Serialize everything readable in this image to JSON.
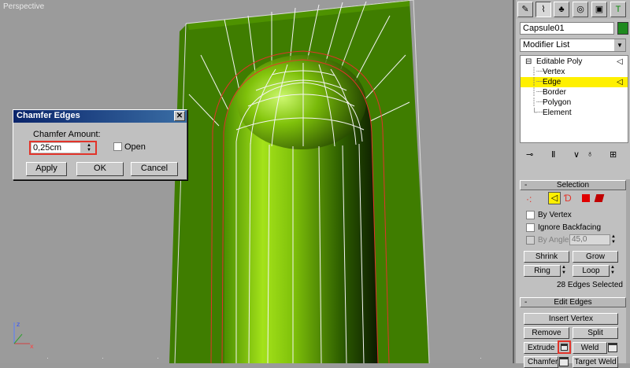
{
  "viewport": {
    "label": "Perspective"
  },
  "dialog": {
    "title": "Chamfer Edges",
    "close_glyph": "✕",
    "amount_label": "Chamfer Amount:",
    "amount_value": "0,25cm",
    "open_label": "Open",
    "apply_label": "Apply",
    "ok_label": "OK",
    "cancel_label": "Cancel"
  },
  "panel": {
    "tabs": [
      "create-icon",
      "modify-icon",
      "hierarchy-icon",
      "motion-icon",
      "display-icon",
      "utilities-icon"
    ],
    "object_name": "Capsule01",
    "object_color": "#1f8a1f",
    "modifier_list": "Modifier List",
    "stack": {
      "root": "Editable Poly",
      "items": [
        "Vertex",
        "Edge",
        "Border",
        "Polygon",
        "Element"
      ],
      "selected": "Edge"
    },
    "selection": {
      "header": "Selection",
      "by_vertex": "By Vertex",
      "ignore_backfacing": "Ignore Backfacing",
      "by_angle": "By Angle:",
      "angle_value": "45,0",
      "shrink": "Shrink",
      "grow": "Grow",
      "ring": "Ring",
      "loop": "Loop",
      "status": "28 Edges Selected"
    },
    "edit_edges": {
      "header": "Edit Edges",
      "insert_vertex": "Insert Vertex",
      "remove": "Remove",
      "split": "Split",
      "extrude": "Extrude",
      "weld": "Weld",
      "chamfer": "Chamfer",
      "target_weld": "Target Weld"
    },
    "rollout_minus": "-"
  },
  "colors": {
    "accent_red": "#e2342a",
    "highlight_yellow": "#fff000",
    "mesh_green": "#3f7d00"
  }
}
